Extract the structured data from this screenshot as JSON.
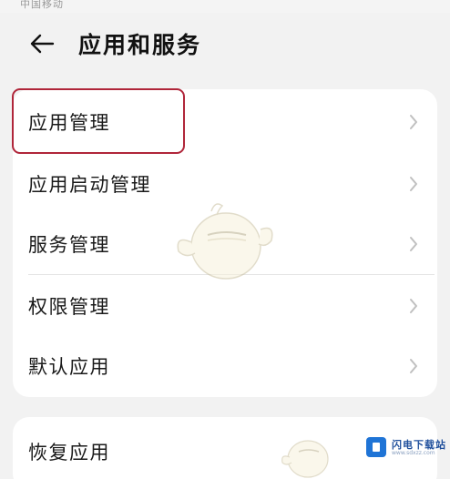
{
  "status_bar": {
    "text": "中国移动"
  },
  "header": {
    "title": "应用和服务",
    "back_icon": "arrow-left-icon"
  },
  "main_list": {
    "items": [
      {
        "label": "应用管理",
        "highlighted": true
      },
      {
        "label": "应用启动管理"
      },
      {
        "label": "服务管理"
      },
      {
        "label": "权限管理"
      },
      {
        "label": "默认应用"
      }
    ]
  },
  "secondary_list": {
    "items": [
      {
        "label": "恢复应用"
      }
    ]
  },
  "watermark_badge": {
    "name": "闪电下载站",
    "url": "www.sdxzz.com"
  },
  "colors": {
    "background": "#f2f2f2",
    "card": "#ffffff",
    "highlight_border": "#b0263a",
    "chevron": "#c0c0c0",
    "badge_blue": "#1f74d6"
  }
}
